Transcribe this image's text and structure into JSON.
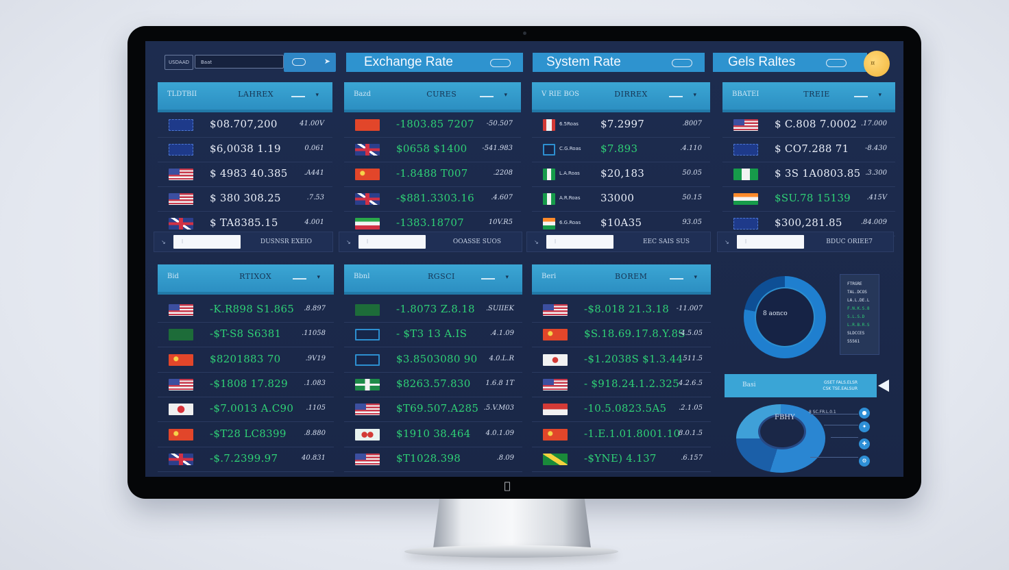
{
  "topbar": {
    "search_tag": "USDAAD",
    "search_value": "Baat",
    "titles": [
      "Exchange Rate",
      "System Rate",
      "Gels Raltes"
    ]
  },
  "panels": [
    {
      "label": "TLDTBII",
      "header": "LAHREX",
      "rows": [
        {
          "flag": "f-eu",
          "name": "",
          "value": "$08.707,200",
          "change": "41.00V",
          "color": "white"
        },
        {
          "flag": "f-eu",
          "name": "",
          "value": "$6,0038 1.19",
          "change": "0.061",
          "color": "white"
        },
        {
          "flag": "f-us",
          "name": "",
          "value": "$ 4983 40.385",
          "change": ".A441",
          "color": "white"
        },
        {
          "flag": "f-us",
          "name": "",
          "value": "$ 380 308.25",
          "change": ".7.53",
          "color": "white"
        },
        {
          "flag": "f-uk",
          "name": "",
          "value": "$ TA8385.15",
          "change": "4.001",
          "color": "white"
        }
      ],
      "footer_text": "DUSNSR EXEIO"
    },
    {
      "label": "Bazd",
      "header": "CURES",
      "rows": [
        {
          "flag": "f-cn",
          "name": "",
          "value": "-1803.85 7207",
          "change": "-50.507",
          "color": "green"
        },
        {
          "flag": "f-uk",
          "name": "",
          "value": "$0658 $1400",
          "change": "-541.983",
          "color": "green"
        },
        {
          "flag": "f-cn2",
          "name": "",
          "value": "-1.8488 T007",
          "change": ".2208",
          "color": "green"
        },
        {
          "flag": "f-uk",
          "name": "",
          "value": "-$881.3303.16",
          "change": ".4.607",
          "color": "green"
        },
        {
          "flag": "f-ir",
          "name": "",
          "value": "-1383.18707",
          "change": "10V.R5",
          "color": "green"
        }
      ],
      "footer_text": "OOASSE SUOS"
    },
    {
      "label": "V RIE BOS",
      "header": "DIRREX",
      "rows": [
        {
          "flag": "f-ca",
          "name": "6.5Roas",
          "value": "$7.2997",
          "change": ".8007",
          "color": "white"
        },
        {
          "flag": "f-ring",
          "name": "C.G.Roas",
          "value": "$7.893",
          "change": ".4.110",
          "color": "green"
        },
        {
          "flag": "f-ng",
          "name": "L.A.Roas",
          "value": "$20,183",
          "change": "50.05",
          "color": "white"
        },
        {
          "flag": "f-ng",
          "name": "A.R.Roas",
          "value": "33000",
          "change": "50.15",
          "color": "white"
        },
        {
          "flag": "f-in",
          "name": "6.G.Roas",
          "value": "$10A35",
          "change": "93.05",
          "color": "white"
        }
      ],
      "footer_text": "EEC SAIS SUS"
    },
    {
      "label": "BBATEI",
      "header": "TREIE",
      "rows": [
        {
          "flag": "f-us",
          "name": "",
          "value": "$ C.808 7.0002",
          "change": ".17.000",
          "color": "white"
        },
        {
          "flag": "f-eu",
          "name": "",
          "value": "$ CO7.288 71",
          "change": "-8.430",
          "color": "white"
        },
        {
          "flag": "f-ng",
          "name": "",
          "value": "$ 3S 1A0803.85",
          "change": ".3.300",
          "color": "white"
        },
        {
          "flag": "f-in",
          "name": "",
          "value": "$SU.78 15139",
          "change": ".415V",
          "color": "green"
        },
        {
          "flag": "f-eu",
          "name": "",
          "value": "$300,281.85",
          "change": ".84.009",
          "color": "white"
        }
      ],
      "footer_text": "BDUC ORIEE7"
    },
    {
      "label": "Bid",
      "header": "RTIXOX",
      "rows": [
        {
          "flag": "f-us",
          "name": "",
          "value": "-K.R898 S1.865",
          "change": ".8.897",
          "color": "green"
        },
        {
          "flag": "f-bg",
          "name": "",
          "value": "-$T-S8 S6381",
          "change": ".11058",
          "color": "green"
        },
        {
          "flag": "f-cn2",
          "name": "",
          "value": "$8201883 70",
          "change": ".9V19",
          "color": "green"
        },
        {
          "flag": "f-us",
          "name": "",
          "value": "-$1808 17.829",
          "change": ".1.083",
          "color": "green"
        },
        {
          "flag": "f-jp",
          "name": "",
          "value": "-$7.0013 A.C90",
          "change": ".1105",
          "color": "green"
        },
        {
          "flag": "f-cn2",
          "name": "",
          "value": "-$T28 LC8399",
          "change": ".8.880",
          "color": "green"
        },
        {
          "flag": "f-uk",
          "name": "",
          "value": "-$.7.2399.97",
          "change": "40.831",
          "color": "green"
        }
      ]
    },
    {
      "label": "Bbnl",
      "header": "RGSCI",
      "rows": [
        {
          "flag": "f-bg",
          "name": "",
          "value": "-1.8073 Z.8.18",
          "change": ".SUIIEK",
          "color": "green"
        },
        {
          "flag": "f-ring",
          "name": "",
          "value": "- $T3 13 A.IS",
          "change": ".4.1.09",
          "color": "green"
        },
        {
          "flag": "f-ring",
          "name": "",
          "value": "$3.8503080 90",
          "change": "4.0.L.R",
          "color": "green"
        },
        {
          "flag": "f-cross",
          "name": "",
          "value": "$8263.57.830",
          "change": "1.6.8 1T",
          "color": "green"
        },
        {
          "flag": "f-us",
          "name": "",
          "value": "$T69.507.A285",
          "change": ".5.V.M03",
          "color": "green"
        },
        {
          "flag": "f-cy",
          "name": "",
          "value": "$1910 38.464",
          "change": "4.0.1.09",
          "color": "green"
        },
        {
          "flag": "f-us",
          "name": "",
          "value": "$T1028.398",
          "change": ".8.09",
          "color": "green"
        }
      ]
    },
    {
      "label": "Beri",
      "header": "BOREM",
      "rows": [
        {
          "flag": "f-us",
          "name": "",
          "value": "-$8.018 21.3.18",
          "change": "-11.007",
          "color": "green"
        },
        {
          "flag": "f-cn2",
          "name": "",
          "value": "$S.18.69.17.8.Y.8S",
          "change": "-4.5.05",
          "color": "green"
        },
        {
          "flag": "f-kr",
          "name": "",
          "value": "-$1.2038S $1.3.44",
          "change": "511.5",
          "color": "green"
        },
        {
          "flag": "f-us",
          "name": "",
          "value": "- $918.24.1.2.325",
          "change": "4.2.6.5",
          "color": "green"
        },
        {
          "flag": "f-red",
          "name": "",
          "value": "-10.5.0823.5A5",
          "change": ".2.1.05",
          "color": "green"
        },
        {
          "flag": "f-cn2",
          "name": "",
          "value": "-1.E.1.01.8001.10",
          "change": "8.0.1.5",
          "color": "green"
        },
        {
          "flag": "f-jm",
          "name": "",
          "value": "-$YNE) 4.137",
          "change": ".6.157",
          "color": "green"
        }
      ]
    }
  ],
  "widgets": {
    "donut1_text": "8 aonco",
    "legend_lines": [
      "FTRGRE",
      "TAL.DCOS",
      "LA.L.DE.L",
      "F.N.K.S.8",
      "S.L.S.D",
      "L.R.B.R.S",
      "SLDCCES",
      "55561"
    ],
    "bar_left": "Basi",
    "bar_right1": "GSET FALS.ELSR",
    "bar_right2": "CSK TSE.EALSUR",
    "donut2_text": "FBHY",
    "donut2_note": "8 SC.FR.L.0.1",
    "legend_icons": [
      "●",
      "✦",
      "✚",
      "⚙"
    ]
  }
}
